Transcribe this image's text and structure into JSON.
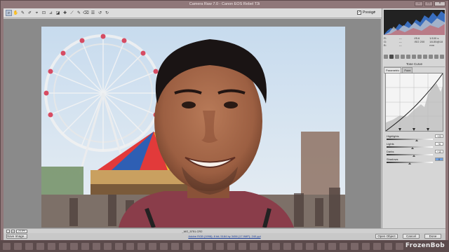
{
  "window": {
    "title": "Camera Raw 7.0  -  Canon EOS Rebel T3i"
  },
  "window_controls": [
    "–",
    "□",
    "×"
  ],
  "toolbar": {
    "tools": [
      "⌕",
      "✋",
      "✎",
      "✐",
      "⌖",
      "⊡",
      "⊿",
      "◪",
      "✚",
      "⟋",
      "✎",
      "⌫",
      "☰",
      "↺",
      "↻"
    ],
    "preview_label": "Preview",
    "preview_checked": "✓",
    "fullscreen_icon": "⤢"
  },
  "info": {
    "rows": [
      [
        "R:",
        "---",
        "f/5.6",
        "1/100 s"
      ],
      [
        "G:",
        "---",
        "ISO 200",
        "18-55@18 mm"
      ],
      [
        "B:",
        "---",
        "",
        ""
      ]
    ]
  },
  "panel": {
    "title": "Tone Curve",
    "subtabs": [
      "Parametric",
      "Point"
    ],
    "sliders": [
      {
        "label": "Highlights",
        "value": "+23"
      },
      {
        "label": "Lights",
        "value": "+6"
      },
      {
        "label": "Darks",
        "value": "+10"
      },
      {
        "label": "Shadows",
        "value": "0"
      }
    ]
  },
  "status": {
    "zoom": "24.8%",
    "zoom_minus": "-",
    "zoom_plus": "+",
    "filename": "_MG_5751.CR2"
  },
  "bottom": {
    "save_label": "Save Image...",
    "workflow_link": "Adobe RGB (1998); 8 bit; 5184 by 3456 (17.9MP); 240 ppi",
    "open_label": "Open Object",
    "cancel_label": "Cancel",
    "done_label": "Done"
  },
  "watermark": "FrozenBob"
}
